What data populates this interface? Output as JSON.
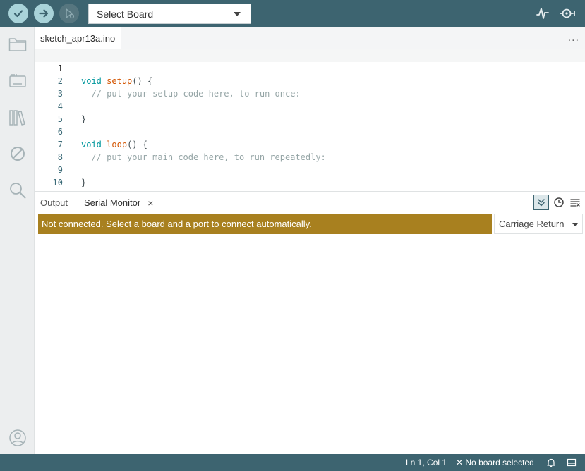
{
  "toolbar": {
    "board_select": "Select Board",
    "icons": [
      "verify-icon",
      "upload-icon",
      "debug-icon",
      "serial-plotter-icon",
      "serial-monitor-icon"
    ]
  },
  "sidebar": {
    "items": [
      {
        "name": "sketchbook",
        "icon": "folder-icon"
      },
      {
        "name": "boards-manager",
        "icon": "board-icon"
      },
      {
        "name": "library-manager",
        "icon": "library-icon"
      },
      {
        "name": "debug",
        "icon": "debug-disabled-icon"
      },
      {
        "name": "search",
        "icon": "search-icon"
      },
      {
        "name": "profile",
        "icon": "user-icon"
      }
    ]
  },
  "editor": {
    "file_tab": "sketch_apr13a.ino",
    "more": "...",
    "lines": [
      {
        "no": "1",
        "t1": "void",
        "t2": " ",
        "t3": "setup",
        "t4": "() {",
        "t5": ""
      },
      {
        "no": "2",
        "t1": "",
        "t2": "",
        "t3": "",
        "t4": "",
        "t5": "  // put your setup code here, to run once:"
      },
      {
        "no": "3",
        "t1": "",
        "t2": "",
        "t3": "",
        "t4": "",
        "t5": ""
      },
      {
        "no": "4",
        "t1": "",
        "t2": "",
        "t3": "",
        "t4": "}",
        "t5": ""
      },
      {
        "no": "5",
        "t1": "",
        "t2": "",
        "t3": "",
        "t4": "",
        "t5": ""
      },
      {
        "no": "6",
        "t1": "void",
        "t2": " ",
        "t3": "loop",
        "t4": "() {",
        "t5": ""
      },
      {
        "no": "7",
        "t1": "",
        "t2": "",
        "t3": "",
        "t4": "",
        "t5": "  // put your main code here, to run repeatedly:"
      },
      {
        "no": "8",
        "t1": "",
        "t2": "",
        "t3": "",
        "t4": "",
        "t5": ""
      },
      {
        "no": "9",
        "t1": "",
        "t2": "",
        "t3": "",
        "t4": "}",
        "t5": ""
      },
      {
        "no": "10",
        "t1": "",
        "t2": "",
        "t3": "",
        "t4": "",
        "t5": ""
      }
    ]
  },
  "panel": {
    "tabs": [
      {
        "label": "Output"
      },
      {
        "label": "Serial Monitor",
        "close": "×"
      }
    ],
    "warning": "Not connected. Select a board and a port to connect automatically.",
    "line_ending": "Carriage Return"
  },
  "status": {
    "position": "Ln 1, Col 1",
    "board": "✕ No board selected"
  },
  "colors": {
    "toolbar": "#3d6470",
    "warning": "#a8801f",
    "keyword": "#00979d",
    "function": "#d35400",
    "comment": "#95a5a6"
  }
}
